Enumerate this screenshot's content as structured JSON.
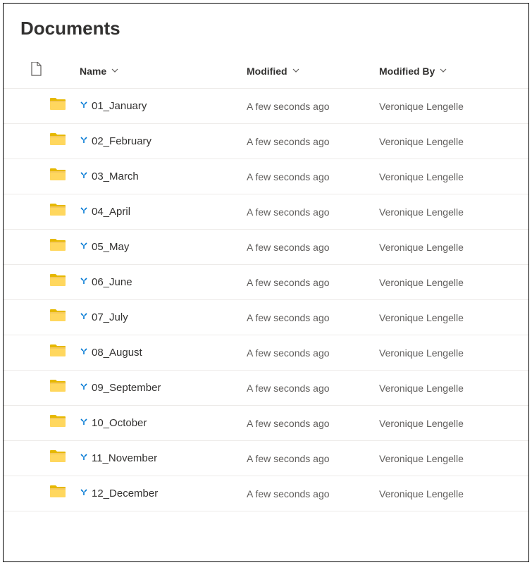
{
  "title": "Documents",
  "columns": {
    "name": "Name",
    "modified": "Modified",
    "modifiedBy": "Modified By"
  },
  "items": [
    {
      "name": "01_January",
      "modified": "A few seconds ago",
      "modifiedBy": "Veronique Lengelle"
    },
    {
      "name": "02_February",
      "modified": "A few seconds ago",
      "modifiedBy": "Veronique Lengelle"
    },
    {
      "name": "03_March",
      "modified": "A few seconds ago",
      "modifiedBy": "Veronique Lengelle"
    },
    {
      "name": "04_April",
      "modified": "A few seconds ago",
      "modifiedBy": "Veronique Lengelle"
    },
    {
      "name": "05_May",
      "modified": "A few seconds ago",
      "modifiedBy": "Veronique Lengelle"
    },
    {
      "name": "06_June",
      "modified": "A few seconds ago",
      "modifiedBy": "Veronique Lengelle"
    },
    {
      "name": "07_July",
      "modified": "A few seconds ago",
      "modifiedBy": "Veronique Lengelle"
    },
    {
      "name": "08_August",
      "modified": "A few seconds ago",
      "modifiedBy": "Veronique Lengelle"
    },
    {
      "name": "09_September",
      "modified": "A few seconds ago",
      "modifiedBy": "Veronique Lengelle"
    },
    {
      "name": "10_October",
      "modified": "A few seconds ago",
      "modifiedBy": "Veronique Lengelle"
    },
    {
      "name": "11_November",
      "modified": "A few seconds ago",
      "modifiedBy": "Veronique Lengelle"
    },
    {
      "name": "12_December",
      "modified": "A few seconds ago",
      "modifiedBy": "Veronique Lengelle"
    }
  ]
}
